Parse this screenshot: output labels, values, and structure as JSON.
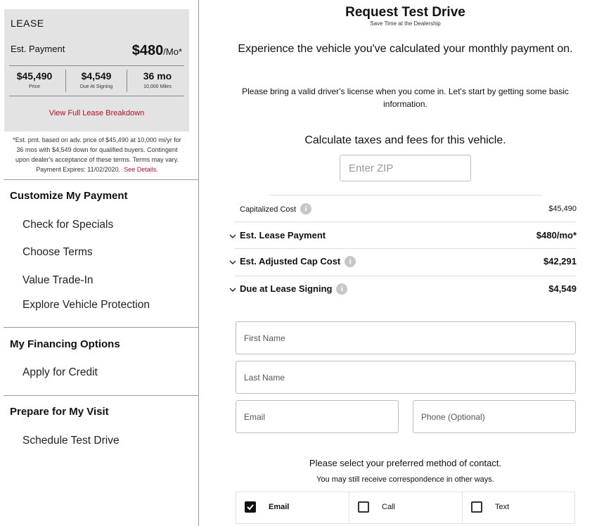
{
  "lease": {
    "title": "LEASE",
    "est_payment_label": "Est. Payment",
    "est_payment_value": "$480",
    "est_payment_unit": "/Mo*",
    "stats": [
      {
        "value": "$45,490",
        "label": "Price"
      },
      {
        "value": "$4,549",
        "label": "Due At Signing"
      },
      {
        "value": "36 mo",
        "label": "10,000 Miles"
      }
    ],
    "breakdown_link": "View Full Lease Breakdown"
  },
  "disclaimer": {
    "line1": "*Est. pmt. based on adv. price of $45,490 at 10,000 mi/yr for",
    "line2": "36 mos with $4,549 down for qualified buyers. Contingent",
    "line3": "upon dealer's acceptance of these terms. Terms may vary.",
    "line4": "Payment Expires: 11/02/2020.",
    "link": "See Details."
  },
  "sidebar": {
    "sections": [
      {
        "heading": "Customize My Payment",
        "items": [
          "Check for Specials",
          "Choose Terms",
          "Value Trade-In",
          "Explore Vehicle Protection"
        ]
      },
      {
        "heading": "My Financing Options",
        "items": [
          "Apply for Credit"
        ]
      },
      {
        "heading": "Prepare for My Visit",
        "items": [
          "Schedule Test Drive"
        ]
      }
    ]
  },
  "main": {
    "title": "Request Test Drive",
    "subtitle": "Save Time at the Dealership",
    "intro": "Experience the vehicle you've calculated your monthly payment on.",
    "note": "Please bring a valid driver's license when you come in. Let's start by getting some basic information.",
    "calc_prompt": "Calculate taxes and fees for this vehicle.",
    "zip_placeholder": "Enter ZIP",
    "cost_rows": [
      {
        "label": "Capitalized Cost",
        "value": "$45,490"
      },
      {
        "label": "Est. Lease Payment",
        "value": "$480/mo*"
      },
      {
        "label": "Est. Adjusted Cap Cost",
        "value": "$42,291"
      },
      {
        "label": "Due at Lease Signing",
        "value": "$4,549"
      }
    ],
    "form": {
      "first_name": "First Name",
      "last_name": "Last Name",
      "email": "Email",
      "phone": "Phone (Optional)"
    },
    "contact": {
      "question": "Please select your preferred method of contact.",
      "note": "You may still receive correspondence in other ways.",
      "options": [
        {
          "label": "Email",
          "checked": true
        },
        {
          "label": "Call",
          "checked": false
        },
        {
          "label": "Text",
          "checked": false
        }
      ]
    }
  },
  "colors": {
    "accent_link": "#b0102a",
    "lease_box_bg": "#e3e3e3"
  }
}
